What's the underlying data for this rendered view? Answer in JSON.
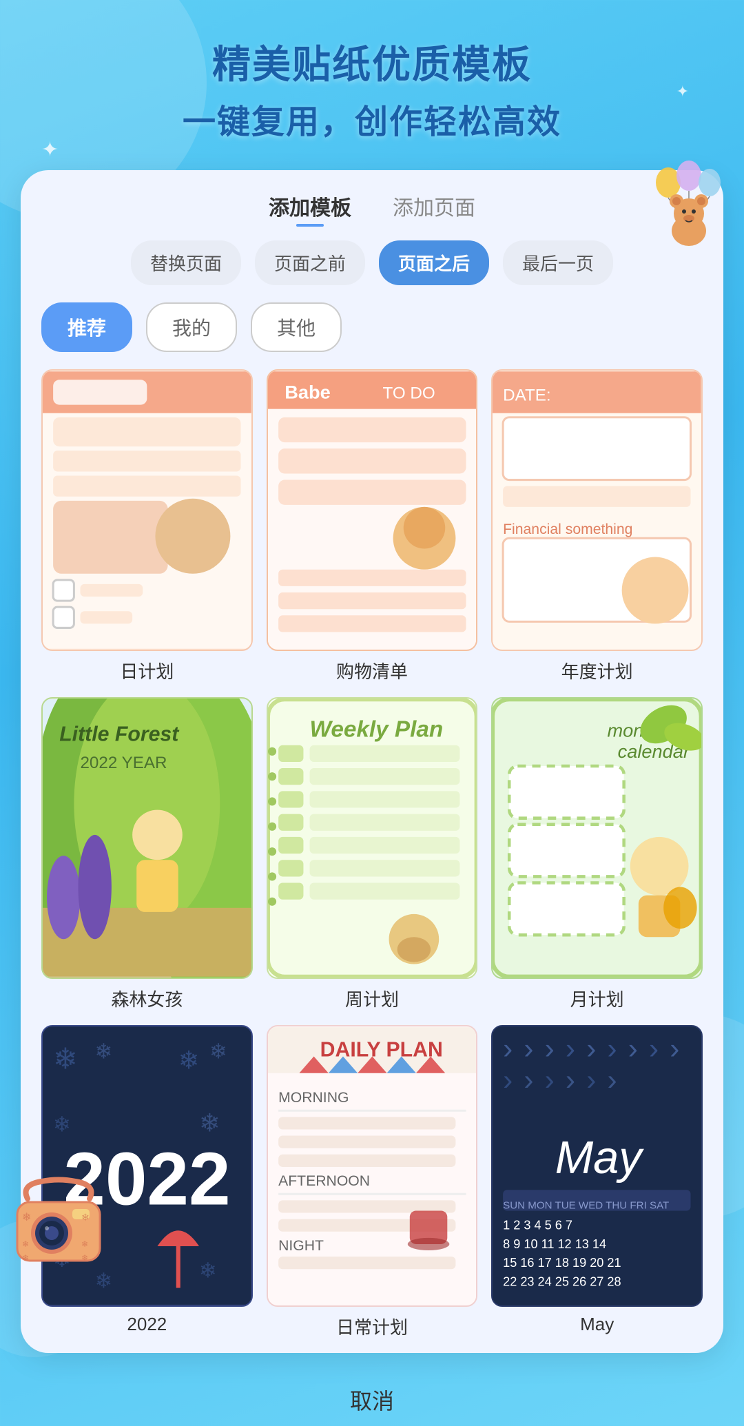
{
  "header": {
    "title_line1": "精美贴纸优质模板",
    "title_line2": "一键复用，创作轻松高效"
  },
  "tabs": [
    {
      "id": "add-template",
      "label": "添加模板",
      "active": true
    },
    {
      "id": "add-page",
      "label": "添加页面",
      "active": false
    }
  ],
  "position_buttons": [
    {
      "id": "replace",
      "label": "替换页面",
      "active": false
    },
    {
      "id": "before",
      "label": "页面之前",
      "active": false
    },
    {
      "id": "after",
      "label": "页面之后",
      "active": true
    },
    {
      "id": "last",
      "label": "最后一页",
      "active": false
    }
  ],
  "categories": [
    {
      "id": "recommend",
      "label": "推荐",
      "active": true
    },
    {
      "id": "mine",
      "label": "我的",
      "active": false
    },
    {
      "id": "other",
      "label": "其他",
      "active": false
    }
  ],
  "templates": [
    {
      "id": "daily",
      "label": "日计划",
      "style": "daily"
    },
    {
      "id": "shopping",
      "label": "购物清单",
      "style": "shopping"
    },
    {
      "id": "annual",
      "label": "年度计划",
      "style": "annual"
    },
    {
      "id": "forest",
      "label": "森林女孩",
      "style": "forest"
    },
    {
      "id": "weekly",
      "label": "周计划",
      "style": "weekly"
    },
    {
      "id": "monthly",
      "label": "月计划",
      "style": "monthly"
    },
    {
      "id": "2022",
      "label": "2022",
      "style": "2022"
    },
    {
      "id": "dailyplan",
      "label": "日常计划",
      "style": "dailyplan"
    },
    {
      "id": "may",
      "label": "May",
      "style": "may"
    }
  ],
  "cancel_label": "取消",
  "accent_color": "#4a90e2",
  "sparkles": [
    "✦",
    "✦",
    "✦",
    "✦"
  ]
}
